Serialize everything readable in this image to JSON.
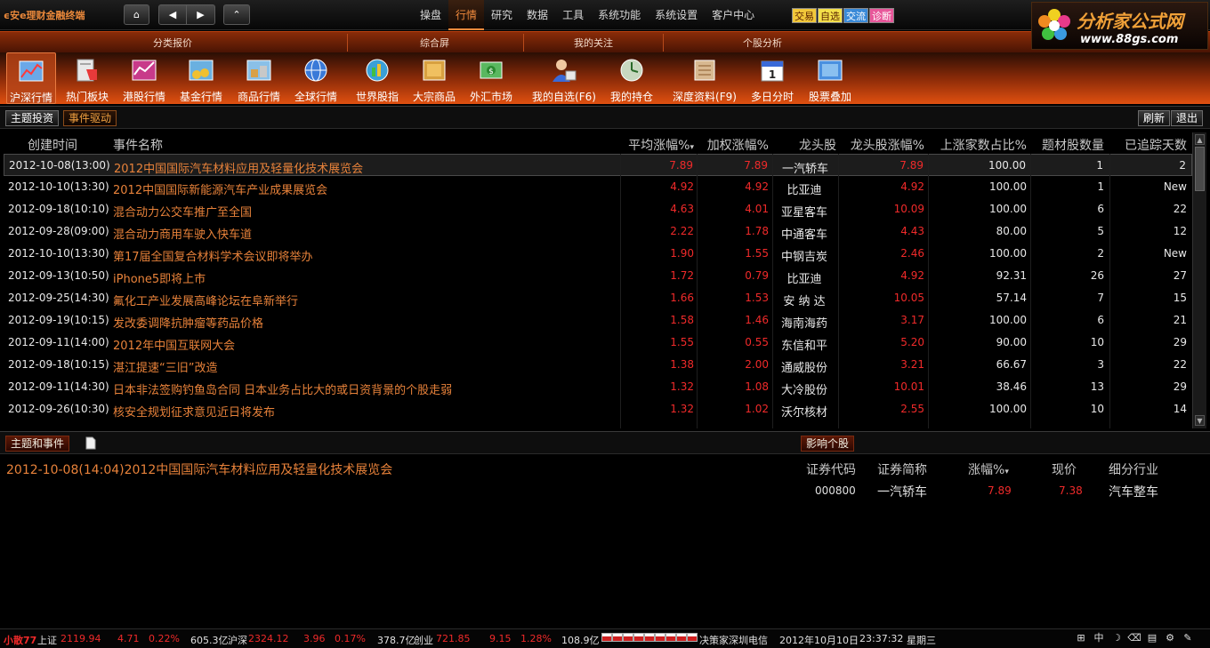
{
  "app": {
    "title": "安e理财金融终端"
  },
  "nav": {
    "home": "⌂",
    "back": "◀",
    "forward": "▶",
    "up": "⌃"
  },
  "menu": [
    "操盘",
    "行情",
    "研究",
    "数据",
    "工具",
    "系统功能",
    "系统设置",
    "客户中心"
  ],
  "menu_active": "行情",
  "quick_tags": [
    "交易",
    "自选",
    "交流",
    "诊断"
  ],
  "logo": {
    "name": "分析家公式网",
    "url": "www.88gs.com"
  },
  "categories": [
    "分类报价",
    "综合屏",
    "我的关注",
    "个股分析"
  ],
  "toolbar": [
    {
      "label": "沪深行情",
      "icon": "market-chart-icon"
    },
    {
      "label": "热门板块",
      "icon": "hot-sector-icon"
    },
    {
      "label": "港股行情",
      "icon": "hk-stock-icon"
    },
    {
      "label": "基金行情",
      "icon": "fund-icon"
    },
    {
      "label": "商品行情",
      "icon": "commodity-icon"
    },
    {
      "label": "全球行情",
      "icon": "globe-icon"
    },
    {
      "label": "世界股指",
      "icon": "world-index-icon"
    },
    {
      "label": "大宗商品",
      "icon": "bulk-commodity-icon"
    },
    {
      "label": "外汇市场",
      "icon": "forex-icon"
    },
    {
      "label": "我的自选(F6)",
      "icon": "my-watchlist-icon"
    },
    {
      "label": "我的持仓",
      "icon": "my-position-icon"
    },
    {
      "label": "深度资料(F9)",
      "icon": "deep-data-icon"
    },
    {
      "label": "多日分时",
      "icon": "calendar-icon"
    },
    {
      "label": "股票叠加",
      "icon": "stock-overlay-icon"
    }
  ],
  "calendar_day": "1",
  "top_tabs": {
    "theme": "主题投资",
    "event": "事件驱动"
  },
  "actions": {
    "refresh": "刷新",
    "exit": "退出"
  },
  "table": {
    "headers": [
      "创建时间",
      "事件名称",
      "平均涨幅%",
      "加权涨幅%",
      "龙头股",
      "龙头股涨幅%",
      "上涨家数占比%",
      "题材股数量",
      "已追踪天数"
    ],
    "sort_marker": "▾",
    "rows": [
      [
        "2012-10-08(13:00)",
        "2012中国国际汽车材料应用及轻量化技术展览会",
        "7.89",
        "7.89",
        "一汽轿车",
        "7.89",
        "100.00",
        "1",
        "2"
      ],
      [
        "2012-10-10(13:30)",
        "2012中国国际新能源汽车产业成果展览会",
        "4.92",
        "4.92",
        "比亚迪",
        "4.92",
        "100.00",
        "1",
        "New"
      ],
      [
        "2012-09-18(10:10)",
        "混合动力公交车推广至全国",
        "4.63",
        "4.01",
        "亚星客车",
        "10.09",
        "100.00",
        "6",
        "22"
      ],
      [
        "2012-09-28(09:00)",
        "混合动力商用车驶入快车道",
        "2.22",
        "1.78",
        "中通客车",
        "4.43",
        "80.00",
        "5",
        "12"
      ],
      [
        "2012-10-10(13:30)",
        "第17届全国复合材料学术会议即将举办",
        "1.90",
        "1.55",
        "中钢吉炭",
        "2.46",
        "100.00",
        "2",
        "New"
      ],
      [
        "2012-09-13(10:50)",
        "iPhone5即将上市",
        "1.72",
        "0.79",
        "比亚迪",
        "4.92",
        "92.31",
        "26",
        "27"
      ],
      [
        "2012-09-25(14:30)",
        "氟化工产业发展高峰论坛在阜新举行",
        "1.66",
        "1.53",
        "安 纳 达",
        "10.05",
        "57.14",
        "7",
        "15"
      ],
      [
        "2012-09-19(10:15)",
        "发改委调降抗肿瘤等药品价格",
        "1.58",
        "1.46",
        "海南海药",
        "3.17",
        "100.00",
        "6",
        "21"
      ],
      [
        "2012-09-11(14:00)",
        "2012年中国互联网大会",
        "1.55",
        "0.55",
        "东信和平",
        "5.20",
        "90.00",
        "10",
        "29"
      ],
      [
        "2012-09-18(10:15)",
        "湛江提速“三旧”改造",
        "1.38",
        "2.00",
        "通威股份",
        "3.21",
        "66.67",
        "3",
        "22"
      ],
      [
        "2012-09-11(14:30)",
        "日本非法签购钓鱼岛合同 日本业务占比大的或日资背景的个股走弱",
        "1.32",
        "1.08",
        "大冷股份",
        "10.01",
        "38.46",
        "13",
        "29"
      ],
      [
        "2012-09-26(10:30)",
        "核安全规划征求意见近日将发布",
        "1.32",
        "1.02",
        "沃尔核材",
        "2.55",
        "100.00",
        "10",
        "14"
      ]
    ]
  },
  "bottom": {
    "tab_theme_event": "主题和事件",
    "tab_impact": "影响个股",
    "event_line": "2012-10-08(14:04)2012中国国际汽车材料应用及轻量化技术展览会",
    "stock_headers": [
      "证券代码",
      "证券简称",
      "涨幅%",
      "现价",
      "细分行业"
    ],
    "stocks": [
      [
        "000800",
        "一汽轿车",
        "7.89",
        "7.38",
        "汽车整车"
      ]
    ]
  },
  "status": {
    "user": "小散77",
    "sh_label": "上证",
    "sh_value": "2119.94",
    "sh_change": "4.71",
    "sh_pct": "0.22%",
    "sh_volume": "605.3亿",
    "sz_label": "沪深",
    "sz_value": "2324.12",
    "sz_change": "3.96",
    "sz_pct": "0.17%",
    "sz_volume": "378.7亿",
    "cy_label": "创业",
    "cy_value": "721.85",
    "cy_change": "9.15",
    "cy_pct": "1.28%",
    "cy_volume": "108.9亿",
    "server": "决策家深圳电信",
    "date": "2012年10月10日",
    "time": "23:37:32",
    "weekday": "星期三",
    "tray": [
      "⊞",
      "中",
      "☽",
      "⌫",
      "▤",
      "⚙",
      "✎"
    ]
  },
  "colors": {
    "accent": "#f08a3c",
    "up": "#f02a2a",
    "toolbar": "#c04010",
    "background": "#000000"
  }
}
